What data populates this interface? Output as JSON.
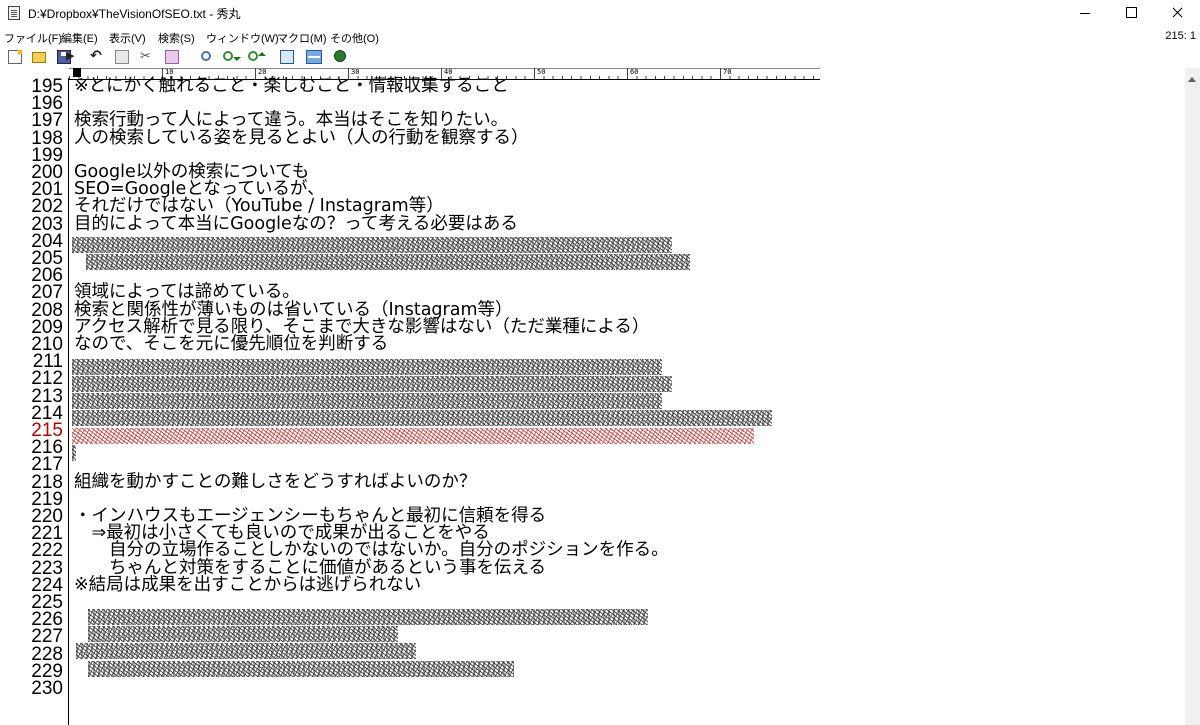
{
  "window": {
    "title": "D:¥Dropbox¥TheVisionOfSEO.txt - 秀丸"
  },
  "menu": [
    "ファイル(F)",
    "編集(E)",
    "表示(V)",
    "検索(S)",
    "ウィンドウ(W)",
    "マクロ(M)",
    "その他(O)"
  ],
  "cursor_position": "215: 1",
  "ruler": {
    "marks": [
      "10",
      "20",
      "30",
      "40",
      "50",
      "60",
      "70"
    ]
  },
  "current_line": "215",
  "lines": [
    {
      "n": "195",
      "text": "※とにかく触れること・楽しむこと・情報収集すること"
    },
    {
      "n": "196",
      "text": ""
    },
    {
      "n": "197",
      "text": "検索行動って人によって違う。本当はそこを知りたい。"
    },
    {
      "n": "198",
      "text": "人の検索している姿を見るとよい（人の行動を観察する）"
    },
    {
      "n": "199",
      "text": ""
    },
    {
      "n": "200",
      "text": "Google以外の検索についても"
    },
    {
      "n": "201",
      "text": "SEO=Googleとなっているが、"
    },
    {
      "n": "202",
      "text": "それだけではない（YouTube / Instagram等）"
    },
    {
      "n": "203",
      "text": "目的によって本当にGoogleなの？って考える必要はある"
    },
    {
      "n": "204",
      "text": ""
    },
    {
      "n": "205",
      "text": ""
    },
    {
      "n": "206",
      "text": ""
    },
    {
      "n": "207",
      "text": "領域によっては諦めている。"
    },
    {
      "n": "208",
      "text": "検索と関係性が薄いものは省いている（Instagram等）"
    },
    {
      "n": "209",
      "text": "アクセス解析で見る限り、そこまで大きな影響はない（ただ業種による）"
    },
    {
      "n": "210",
      "text": "なので、そこを元に優先順位を判断する"
    },
    {
      "n": "211",
      "text": ""
    },
    {
      "n": "212",
      "text": ""
    },
    {
      "n": "213",
      "text": ""
    },
    {
      "n": "214",
      "text": ""
    },
    {
      "n": "215",
      "text": ""
    },
    {
      "n": "216",
      "text": ""
    },
    {
      "n": "217",
      "text": ""
    },
    {
      "n": "218",
      "text": "組織を動かすことの難しさをどうすればよいのか？"
    },
    {
      "n": "219",
      "text": ""
    },
    {
      "n": "220",
      "text": "・インハウスもエージェンシーもちゃんと最初に信頼を得る"
    },
    {
      "n": "221",
      "text": "　⇒最初は小さくても良いので成果が出ることをやる"
    },
    {
      "n": "222",
      "text": "　　自分の立場作ることしかないのではないか。自分のポジションを作る。"
    },
    {
      "n": "223",
      "text": "　　ちゃんと対策をすることに価値があるという事を伝える"
    },
    {
      "n": "224",
      "text": "※結局は成果を出すことからは逃げられない"
    },
    {
      "n": "225",
      "text": ""
    },
    {
      "n": "226",
      "text": ""
    },
    {
      "n": "227",
      "text": ""
    },
    {
      "n": "228",
      "text": ""
    },
    {
      "n": "229",
      "text": ""
    },
    {
      "n": "230",
      "text": ""
    }
  ],
  "colors": {
    "current_line_number": "#b40000",
    "redaction_current_line": "#b40000"
  }
}
